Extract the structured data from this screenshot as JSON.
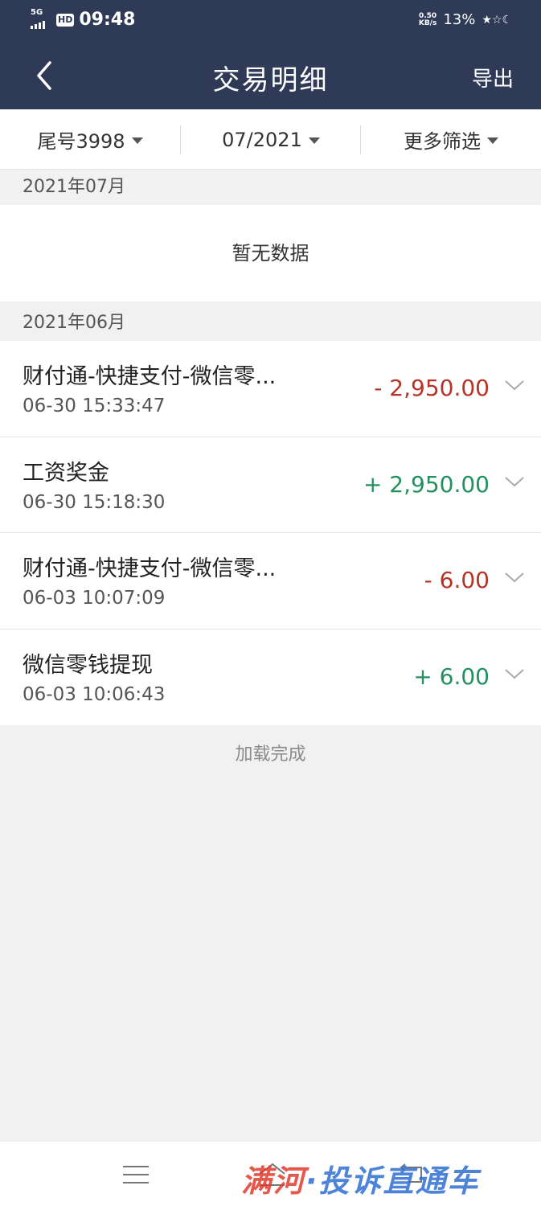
{
  "status_bar": {
    "network": "5G",
    "hd": "HD",
    "time": "09:48",
    "net_speed_value": "0.50",
    "net_speed_unit": "KB/s",
    "battery": "13%"
  },
  "nav": {
    "title": "交易明细",
    "export_label": "导出"
  },
  "filters": {
    "account": "尾号3998",
    "month": "07/2021",
    "more": "更多筛选"
  },
  "sections": [
    {
      "month": "2021年07月",
      "empty_text": "暂无数据"
    },
    {
      "month": "2021年06月"
    }
  ],
  "transactions": [
    {
      "title": "财付通-快捷支付-微信零...",
      "time": "06-30 15:33:47",
      "amount": "- 2,950.00",
      "direction": "out"
    },
    {
      "title": "工资奖金",
      "time": "06-30 15:18:30",
      "amount": "+ 2,950.00",
      "direction": "in"
    },
    {
      "title": "财付通-快捷支付-微信零...",
      "time": "06-03 10:07:09",
      "amount": "- 6.00",
      "direction": "out"
    },
    {
      "title": "微信零钱提现",
      "time": "06-03 10:06:43",
      "amount": "+ 6.00",
      "direction": "in"
    }
  ],
  "load_status": "加载完成",
  "watermark": {
    "part1": "满河",
    "part2": "·投诉直通车"
  },
  "colors": {
    "header_bg": "#2f3a57",
    "outflow": "#b63325",
    "inflow": "#21915f"
  },
  "icons": [
    "back-arrow-icon",
    "caret-down-icon",
    "chevron-down-icon",
    "menu-icon",
    "home-icon",
    "back-icon"
  ]
}
